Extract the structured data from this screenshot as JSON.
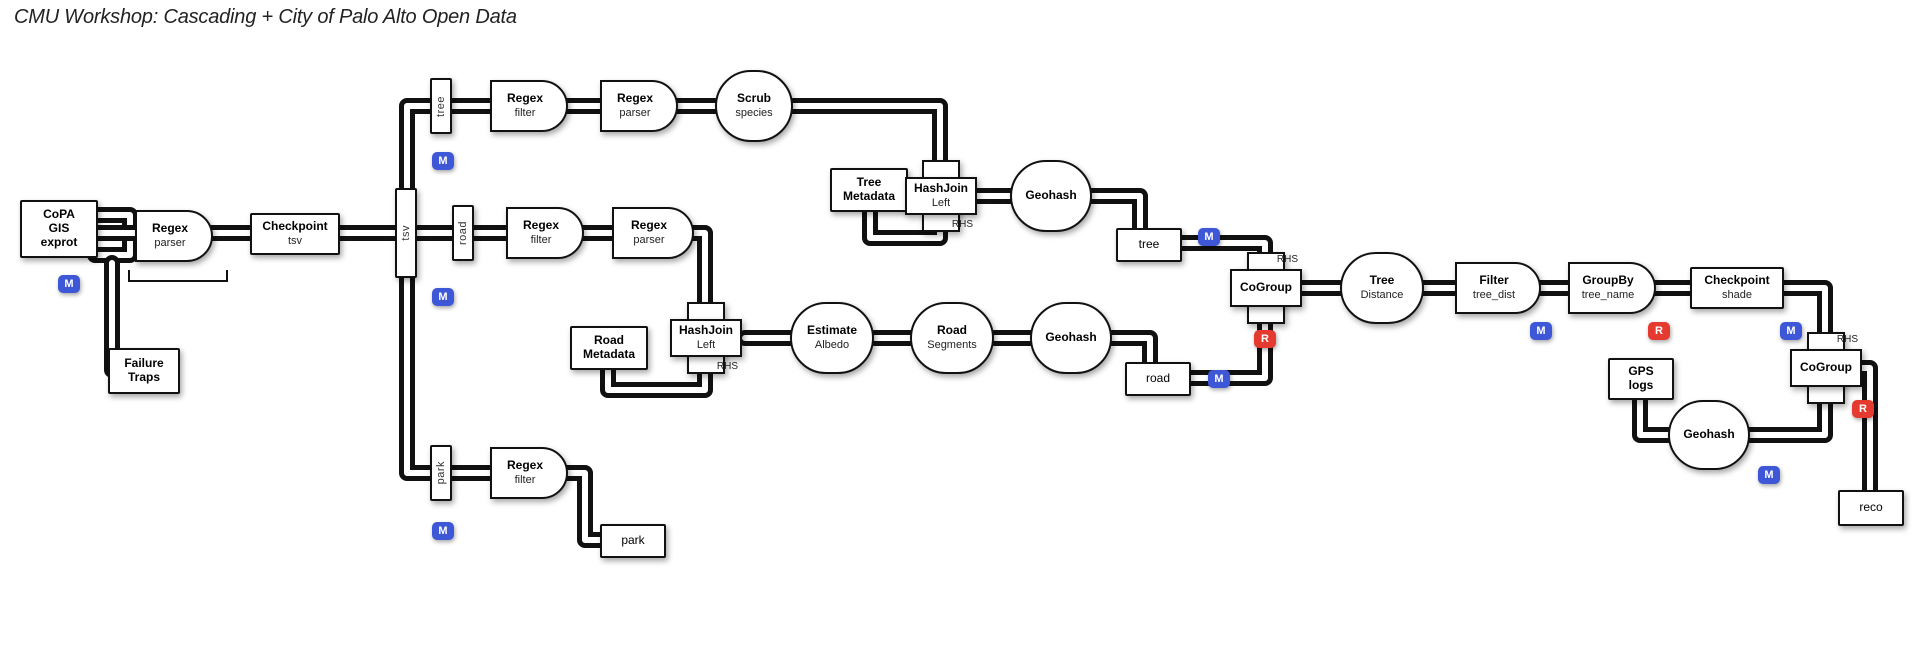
{
  "title": "CMU Workshop: Cascading + City of Palo Alto Open Data",
  "taps": {
    "copa": {
      "l1": "CoPA",
      "l2": "GIS exprot"
    },
    "failure_traps": {
      "l1": "Failure",
      "l2": "Traps"
    },
    "tree_meta": {
      "l1": "Tree",
      "l2": "Metadata"
    },
    "road_meta": {
      "l1": "Road",
      "l2": "Metadata"
    },
    "tree_sink": {
      "l1": "tree"
    },
    "road_sink": {
      "l1": "road"
    },
    "park_sink": {
      "l1": "park"
    },
    "gps_logs": {
      "l1": "GPS",
      "l2": "logs"
    },
    "reco_sink": {
      "l1": "reco"
    }
  },
  "checkpoints": {
    "tsv": {
      "l1": "Checkpoint",
      "l2": "tsv"
    },
    "shade": {
      "l1": "Checkpoint",
      "l2": "shade"
    }
  },
  "splitters": {
    "tsv": "tsv",
    "tree": "tree",
    "road": "road",
    "park": "park"
  },
  "ops": {
    "regex_parser_1": {
      "l1": "Regex",
      "l2": "parser"
    },
    "regex_filter_tree": {
      "l1": "Regex",
      "l2": "filter"
    },
    "regex_parser_tree": {
      "l1": "Regex",
      "l2": "parser"
    },
    "scrub_species": {
      "l1": "Scrub",
      "l2": "species"
    },
    "regex_filter_road": {
      "l1": "Regex",
      "l2": "filter"
    },
    "regex_parser_road": {
      "l1": "Regex",
      "l2": "parser"
    },
    "regex_filter_park": {
      "l1": "Regex",
      "l2": "filter"
    },
    "hashjoin_tree": {
      "l1": "HashJoin",
      "l2": "Left",
      "rhs": "RHS"
    },
    "hashjoin_road": {
      "l1": "HashJoin",
      "l2": "Left",
      "rhs": "RHS"
    },
    "estimate_albedo": {
      "l1": "Estimate",
      "l2": "Albedo"
    },
    "road_segments": {
      "l1": "Road",
      "l2": "Segments"
    },
    "geohash_tree": {
      "l1": "Geohash"
    },
    "geohash_road": {
      "l1": "Geohash"
    },
    "geohash_gps": {
      "l1": "Geohash"
    },
    "cogroup_1": {
      "l1": "CoGroup",
      "rhs": "RHS"
    },
    "cogroup_2": {
      "l1": "CoGroup",
      "rhs": "RHS"
    },
    "tree_distance": {
      "l1": "Tree",
      "l2": "Distance"
    },
    "filter_tree_dist": {
      "l1": "Filter",
      "l2": "tree_dist"
    },
    "groupby_tree_name": {
      "l1": "GroupBy",
      "l2": "tree_name"
    }
  },
  "badges": {
    "m": "M",
    "r": "R"
  }
}
